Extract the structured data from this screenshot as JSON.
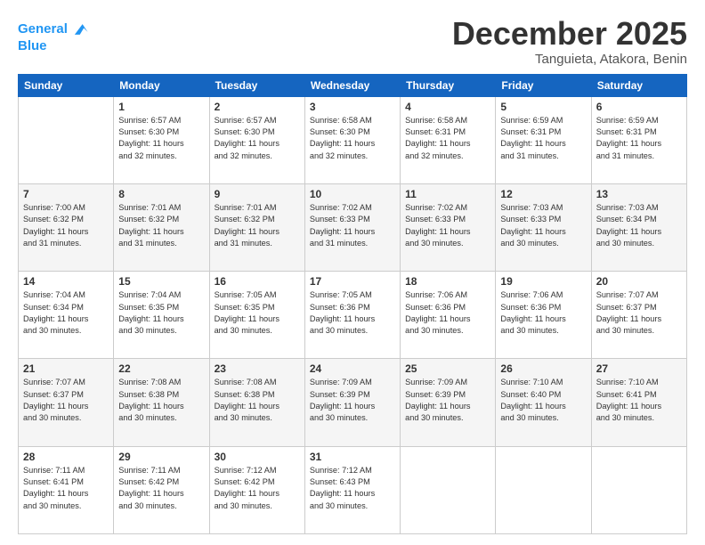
{
  "logo": {
    "line1": "General",
    "line2": "Blue"
  },
  "title": "December 2025",
  "location": "Tanguieta, Atakora, Benin",
  "days_of_week": [
    "Sunday",
    "Monday",
    "Tuesday",
    "Wednesday",
    "Thursday",
    "Friday",
    "Saturday"
  ],
  "weeks": [
    [
      {
        "day": "",
        "info": ""
      },
      {
        "day": "1",
        "info": "Sunrise: 6:57 AM\nSunset: 6:30 PM\nDaylight: 11 hours\nand 32 minutes."
      },
      {
        "day": "2",
        "info": "Sunrise: 6:57 AM\nSunset: 6:30 PM\nDaylight: 11 hours\nand 32 minutes."
      },
      {
        "day": "3",
        "info": "Sunrise: 6:58 AM\nSunset: 6:30 PM\nDaylight: 11 hours\nand 32 minutes."
      },
      {
        "day": "4",
        "info": "Sunrise: 6:58 AM\nSunset: 6:31 PM\nDaylight: 11 hours\nand 32 minutes."
      },
      {
        "day": "5",
        "info": "Sunrise: 6:59 AM\nSunset: 6:31 PM\nDaylight: 11 hours\nand 31 minutes."
      },
      {
        "day": "6",
        "info": "Sunrise: 6:59 AM\nSunset: 6:31 PM\nDaylight: 11 hours\nand 31 minutes."
      }
    ],
    [
      {
        "day": "7",
        "info": "Sunrise: 7:00 AM\nSunset: 6:32 PM\nDaylight: 11 hours\nand 31 minutes."
      },
      {
        "day": "8",
        "info": "Sunrise: 7:01 AM\nSunset: 6:32 PM\nDaylight: 11 hours\nand 31 minutes."
      },
      {
        "day": "9",
        "info": "Sunrise: 7:01 AM\nSunset: 6:32 PM\nDaylight: 11 hours\nand 31 minutes."
      },
      {
        "day": "10",
        "info": "Sunrise: 7:02 AM\nSunset: 6:33 PM\nDaylight: 11 hours\nand 31 minutes."
      },
      {
        "day": "11",
        "info": "Sunrise: 7:02 AM\nSunset: 6:33 PM\nDaylight: 11 hours\nand 30 minutes."
      },
      {
        "day": "12",
        "info": "Sunrise: 7:03 AM\nSunset: 6:33 PM\nDaylight: 11 hours\nand 30 minutes."
      },
      {
        "day": "13",
        "info": "Sunrise: 7:03 AM\nSunset: 6:34 PM\nDaylight: 11 hours\nand 30 minutes."
      }
    ],
    [
      {
        "day": "14",
        "info": "Sunrise: 7:04 AM\nSunset: 6:34 PM\nDaylight: 11 hours\nand 30 minutes."
      },
      {
        "day": "15",
        "info": "Sunrise: 7:04 AM\nSunset: 6:35 PM\nDaylight: 11 hours\nand 30 minutes."
      },
      {
        "day": "16",
        "info": "Sunrise: 7:05 AM\nSunset: 6:35 PM\nDaylight: 11 hours\nand 30 minutes."
      },
      {
        "day": "17",
        "info": "Sunrise: 7:05 AM\nSunset: 6:36 PM\nDaylight: 11 hours\nand 30 minutes."
      },
      {
        "day": "18",
        "info": "Sunrise: 7:06 AM\nSunset: 6:36 PM\nDaylight: 11 hours\nand 30 minutes."
      },
      {
        "day": "19",
        "info": "Sunrise: 7:06 AM\nSunset: 6:36 PM\nDaylight: 11 hours\nand 30 minutes."
      },
      {
        "day": "20",
        "info": "Sunrise: 7:07 AM\nSunset: 6:37 PM\nDaylight: 11 hours\nand 30 minutes."
      }
    ],
    [
      {
        "day": "21",
        "info": "Sunrise: 7:07 AM\nSunset: 6:37 PM\nDaylight: 11 hours\nand 30 minutes."
      },
      {
        "day": "22",
        "info": "Sunrise: 7:08 AM\nSunset: 6:38 PM\nDaylight: 11 hours\nand 30 minutes."
      },
      {
        "day": "23",
        "info": "Sunrise: 7:08 AM\nSunset: 6:38 PM\nDaylight: 11 hours\nand 30 minutes."
      },
      {
        "day": "24",
        "info": "Sunrise: 7:09 AM\nSunset: 6:39 PM\nDaylight: 11 hours\nand 30 minutes."
      },
      {
        "day": "25",
        "info": "Sunrise: 7:09 AM\nSunset: 6:39 PM\nDaylight: 11 hours\nand 30 minutes."
      },
      {
        "day": "26",
        "info": "Sunrise: 7:10 AM\nSunset: 6:40 PM\nDaylight: 11 hours\nand 30 minutes."
      },
      {
        "day": "27",
        "info": "Sunrise: 7:10 AM\nSunset: 6:41 PM\nDaylight: 11 hours\nand 30 minutes."
      }
    ],
    [
      {
        "day": "28",
        "info": "Sunrise: 7:11 AM\nSunset: 6:41 PM\nDaylight: 11 hours\nand 30 minutes."
      },
      {
        "day": "29",
        "info": "Sunrise: 7:11 AM\nSunset: 6:42 PM\nDaylight: 11 hours\nand 30 minutes."
      },
      {
        "day": "30",
        "info": "Sunrise: 7:12 AM\nSunset: 6:42 PM\nDaylight: 11 hours\nand 30 minutes."
      },
      {
        "day": "31",
        "info": "Sunrise: 7:12 AM\nSunset: 6:43 PM\nDaylight: 11 hours\nand 30 minutes."
      },
      {
        "day": "",
        "info": ""
      },
      {
        "day": "",
        "info": ""
      },
      {
        "day": "",
        "info": ""
      }
    ]
  ]
}
